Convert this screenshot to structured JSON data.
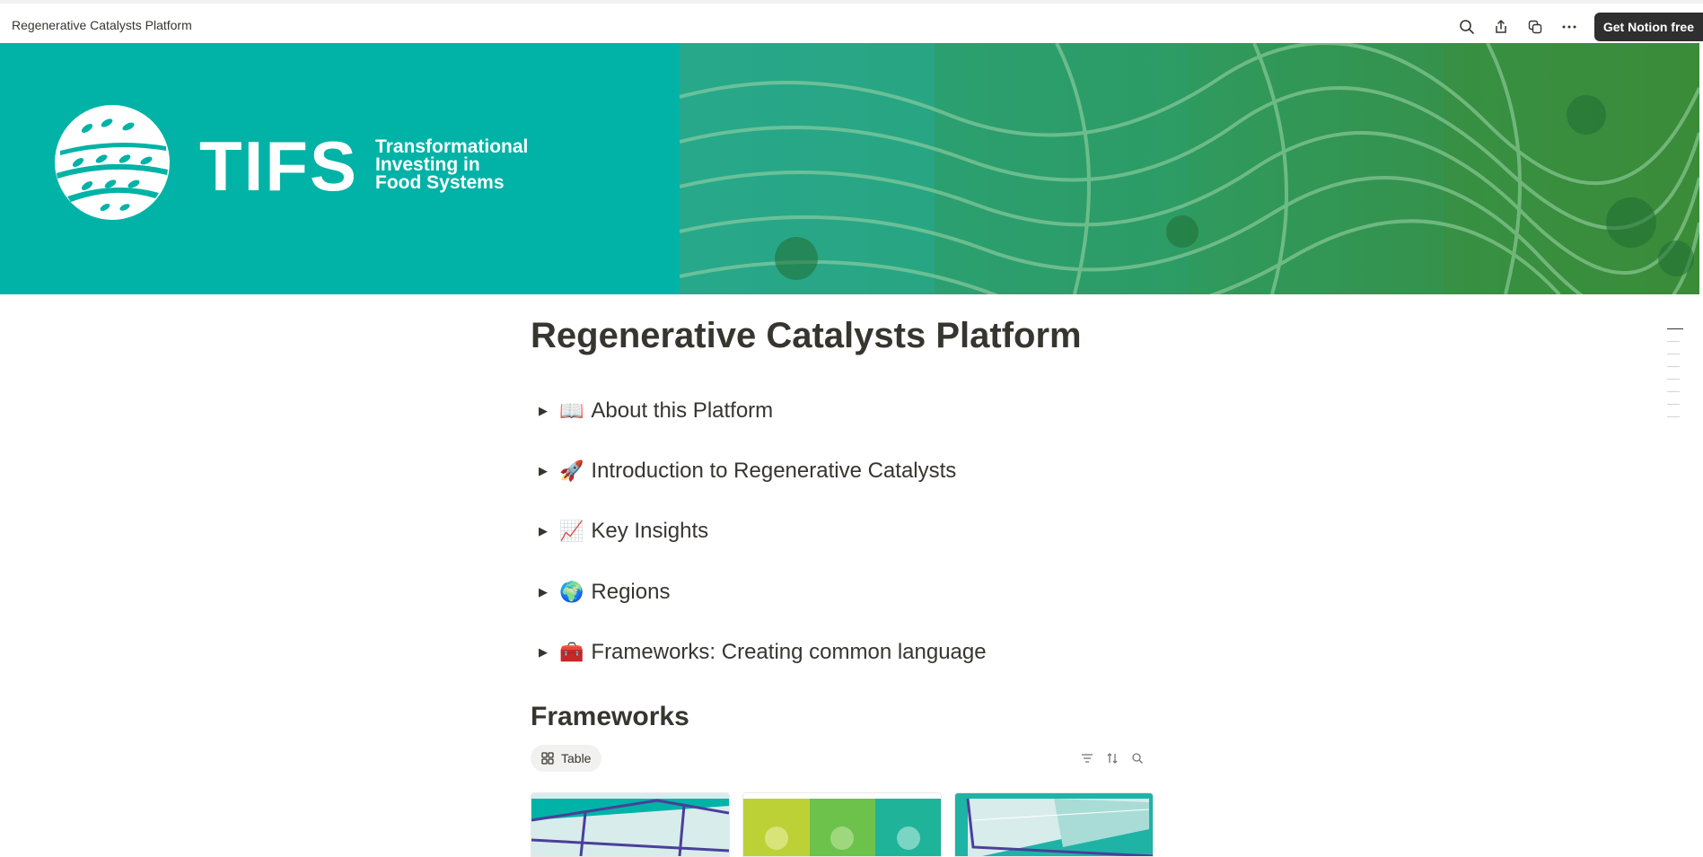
{
  "topbar": {
    "title": "Regenerative Catalysts Platform",
    "actions": [
      {
        "icon": "search-icon"
      },
      {
        "icon": "share-icon"
      },
      {
        "icon": "duplicate-icon"
      },
      {
        "icon": "more-icon"
      }
    ],
    "cta_label": "Get Notion free"
  },
  "cover": {
    "logo_main": "TIFS",
    "logo_sub": [
      "Transformational",
      "Investing in",
      "Food Systems"
    ],
    "left_color": "#00b3a6"
  },
  "page": {
    "title": "Regenerative Catalysts Platform",
    "toggles": [
      {
        "emoji": "📖",
        "label": "About this Platform"
      },
      {
        "emoji": "🚀",
        "label": "Introduction to Regenerative Catalysts"
      },
      {
        "emoji": "📈",
        "label": "Key Insights"
      },
      {
        "emoji": "🌍",
        "label": "Regions"
      },
      {
        "emoji": "🧰",
        "label": "Frameworks: Creating common language"
      }
    ],
    "database": {
      "heading": "Frameworks",
      "view_label": "Table",
      "tools": [
        "filter-icon",
        "sort-icon",
        "search-icon"
      ]
    }
  }
}
